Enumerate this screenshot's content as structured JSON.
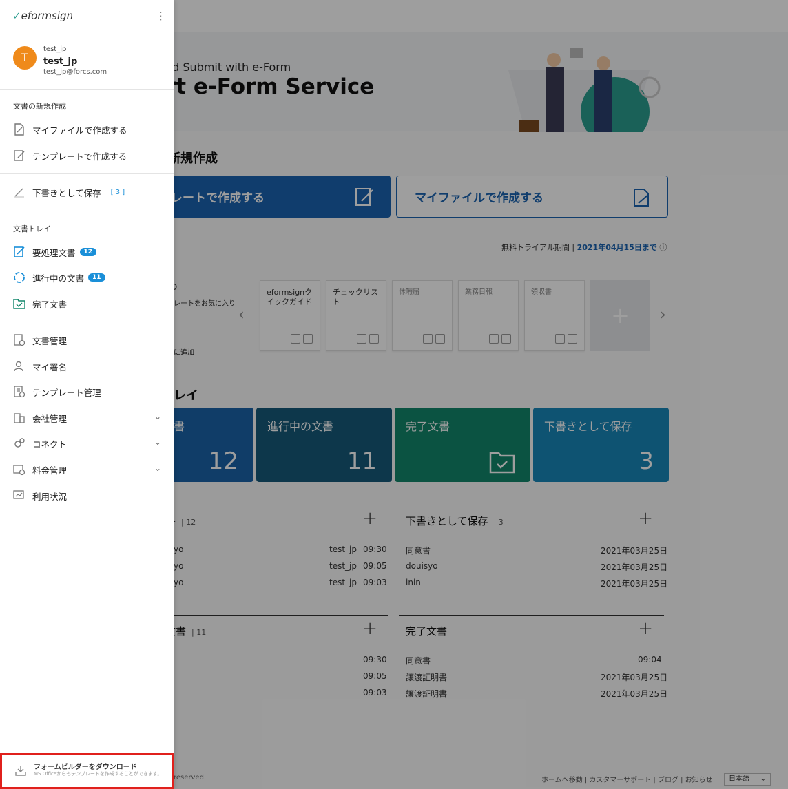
{
  "sidebar": {
    "logo": "eformsign",
    "user": {
      "initial": "T",
      "company": "test_jp",
      "name": "test_jp",
      "email": "test_jp@forcs.com"
    },
    "new_doc_group": "文書の新規作成",
    "create_myfile": "マイファイルで作成する",
    "create_template": "テンプレートで作成する",
    "drafts": {
      "label": "下書きとして保存",
      "count": "[ 3 ]"
    },
    "tray_group": "文書トレイ",
    "action_required": {
      "label": "要処理文書",
      "badge": "12"
    },
    "in_progress": {
      "label": "進行中の文書",
      "badge": "11"
    },
    "completed": "完了文書",
    "doc_mgmt": "文書管理",
    "my_signature": "マイ署名",
    "template_mgmt": "テンプレート管理",
    "company_mgmt": "会社管理",
    "connect": "コネクト",
    "billing": "料金管理",
    "usage": "利用状況",
    "download": {
      "title": "フォームビルダーをダウンロード",
      "desc": "MS Officeからもテンプレートを作成することができます。"
    }
  },
  "main": {
    "banner_sub": "nd Submit with e-Form",
    "banner_title": "rt e-Form Service",
    "new_doc_title": "新規作成",
    "btn_template": "レートで作成する",
    "btn_myfile": "マイファイルで作成する",
    "trial_label": "無料トライアル期間",
    "trial_date": "2021年04月15日まで",
    "fav_frag1": "D",
    "fav_frag2": "レートをお気に入り",
    "fav_frag3": "に追加",
    "templates": [
      "eformsignクイックガイド",
      "チェックリスト",
      "休暇届",
      "業務日報",
      "領収書"
    ],
    "tray_title": "レイ",
    "tiles": [
      {
        "label": "書",
        "count": "12",
        "color": "#1a63a8"
      },
      {
        "label": "進行中の文書",
        "count": "11",
        "color": "#155a7a"
      },
      {
        "label": "完了文書",
        "count": "",
        "color": "#12876b"
      },
      {
        "label": "下書きとして保存",
        "count": "3",
        "color": "#1886b8"
      }
    ],
    "panels": {
      "action": {
        "title": "書",
        "count": "12",
        "rows": [
          {
            "name": "yo",
            "user": "test_jp",
            "time": "09:30"
          },
          {
            "name": "yo",
            "user": "test_jp",
            "time": "09:05"
          },
          {
            "name": "yo",
            "user": "test_jp",
            "time": "09:03"
          }
        ]
      },
      "drafts": {
        "title": "下書きとして保存",
        "count": "3",
        "rows": [
          {
            "name": "同意書",
            "time": "2021年03月25日"
          },
          {
            "name": "douisyo",
            "time": "2021年03月25日"
          },
          {
            "name": "inin",
            "time": "2021年03月25日"
          }
        ]
      },
      "progress": {
        "title": "文書",
        "count": "11",
        "rows": [
          {
            "time": "09:30"
          },
          {
            "time": "09:05"
          },
          {
            "time": "09:03"
          }
        ]
      },
      "completed": {
        "title": "完了文書",
        "rows": [
          {
            "name": "同意書",
            "time": "09:04"
          },
          {
            "name": "譲渡証明書",
            "time": "2021年03月25日"
          },
          {
            "name": "譲渡証明書",
            "time": "2021年03月25日"
          }
        ]
      }
    },
    "footer_left": "reserved.",
    "footer_links": "ホームへ移動 | カスタマーサポート | ブログ | お知らせ",
    "language": "日本語"
  },
  "colors": {
    "accent": "#1a63b0",
    "badge": "#1a8fd8",
    "highlight": "#e0201c"
  }
}
